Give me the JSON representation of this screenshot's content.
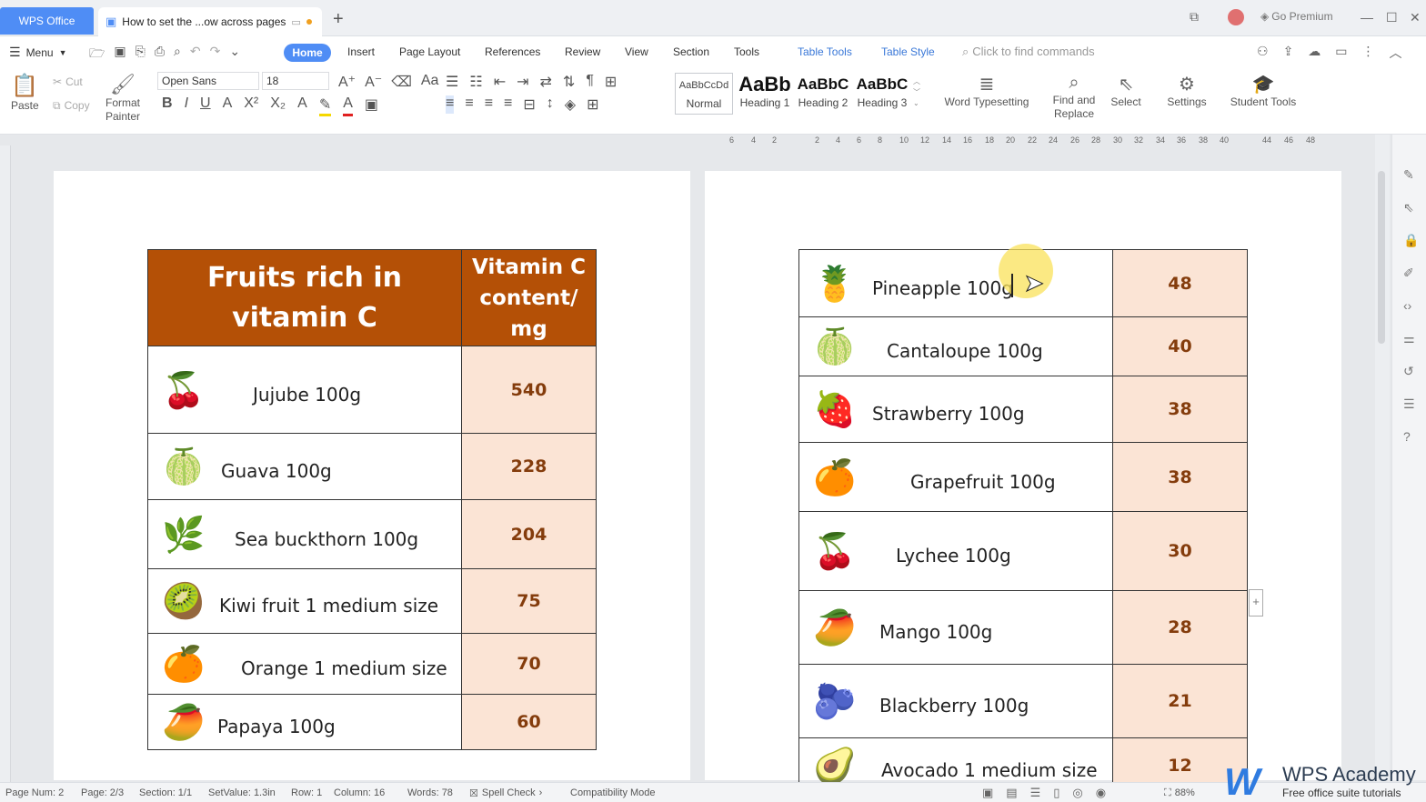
{
  "titlebar": {
    "app_tab": "WPS Office",
    "doc_tab": "How to set the ...ow across pages",
    "premium": "Go Premium"
  },
  "menu": {
    "menu_label": "Menu",
    "tabs": [
      "Home",
      "Insert",
      "Page Layout",
      "References",
      "Review",
      "View",
      "Section",
      "Tools",
      "Table Tools",
      "Table Style"
    ],
    "search_placeholder": "Click to find commands"
  },
  "ribbon": {
    "paste": "Paste",
    "cut": "Cut",
    "copy": "Copy",
    "format_painter_1": "Format",
    "format_painter_2": "Painter",
    "font_name": "Open Sans",
    "font_size": "18",
    "styles": [
      {
        "preview": "AaBbCcDd",
        "name": "Normal"
      },
      {
        "preview": "AaBb",
        "name": "Heading 1"
      },
      {
        "preview": "AaBbC",
        "name": "Heading 2"
      },
      {
        "preview": "AaBbC",
        "name": "Heading 3"
      }
    ],
    "word_typesetting": "Word Typesetting",
    "find_replace_1": "Find and",
    "find_replace_2": "Replace",
    "select": "Select",
    "settings": "Settings",
    "student_tools": "Student Tools"
  },
  "ruler_ticks": [
    "6",
    "4",
    "2",
    "2",
    "4",
    "6",
    "8",
    "10",
    "12",
    "14",
    "16",
    "18",
    "20",
    "22",
    "24",
    "26",
    "28",
    "30",
    "32",
    "34",
    "36",
    "38",
    "40",
    "44",
    "46",
    "48"
  ],
  "table_header": {
    "col1": "Fruits rich in vitamin C",
    "col2": "Vitamin C content/ mg"
  },
  "page1_rows": [
    {
      "name": "Jujube 100g",
      "value": "540",
      "icon": "jujube-icon"
    },
    {
      "name": "Guava 100g",
      "value": "228",
      "icon": "guava-icon"
    },
    {
      "name": "Sea buckthorn 100g",
      "value": "204",
      "icon": "sea-buckthorn-icon"
    },
    {
      "name": "Kiwi fruit 1 medium size",
      "value": "75",
      "icon": "kiwi-icon"
    },
    {
      "name": "Orange  1 medium size",
      "value": "70",
      "icon": "orange-icon"
    },
    {
      "name": "Papaya 100g",
      "value": "60",
      "icon": "papaya-icon"
    }
  ],
  "page2_rows": [
    {
      "name": "Pineapple 100g",
      "value": "48",
      "icon": "pineapple-icon"
    },
    {
      "name": "Cantaloupe 100g",
      "value": "40",
      "icon": "cantaloupe-icon"
    },
    {
      "name": "Strawberry 100g",
      "value": "38",
      "icon": "strawberry-icon"
    },
    {
      "name": "Grapefruit 100g",
      "value": "38",
      "icon": "grapefruit-icon"
    },
    {
      "name": "Lychee 100g",
      "value": "30",
      "icon": "lychee-icon"
    },
    {
      "name": "Mango 100g",
      "value": "28",
      "icon": "mango-icon"
    },
    {
      "name": "Blackberry 100g",
      "value": "21",
      "icon": "blackberry-icon"
    },
    {
      "name": "Avocado  1 medium size",
      "value": "12",
      "icon": "avocado-icon"
    }
  ],
  "status": {
    "page_num": "Page Num: 2",
    "page": "Page: 2/3",
    "section": "Section: 1/1",
    "setvalue": "SetValue: 1.3in",
    "row": "Row: 1",
    "column": "Column: 16",
    "words": "Words: 78",
    "spell_check": "Spell Check",
    "compat": "Compatibility Mode",
    "zoom": "88%"
  },
  "brand": {
    "name": "WPS Academy",
    "tagline": "Free office suite tutorials"
  },
  "colors": {
    "header_bg": "#b45006",
    "value_bg": "#fbe4d5",
    "value_text": "#843c0c",
    "accent": "#4f8df5"
  }
}
